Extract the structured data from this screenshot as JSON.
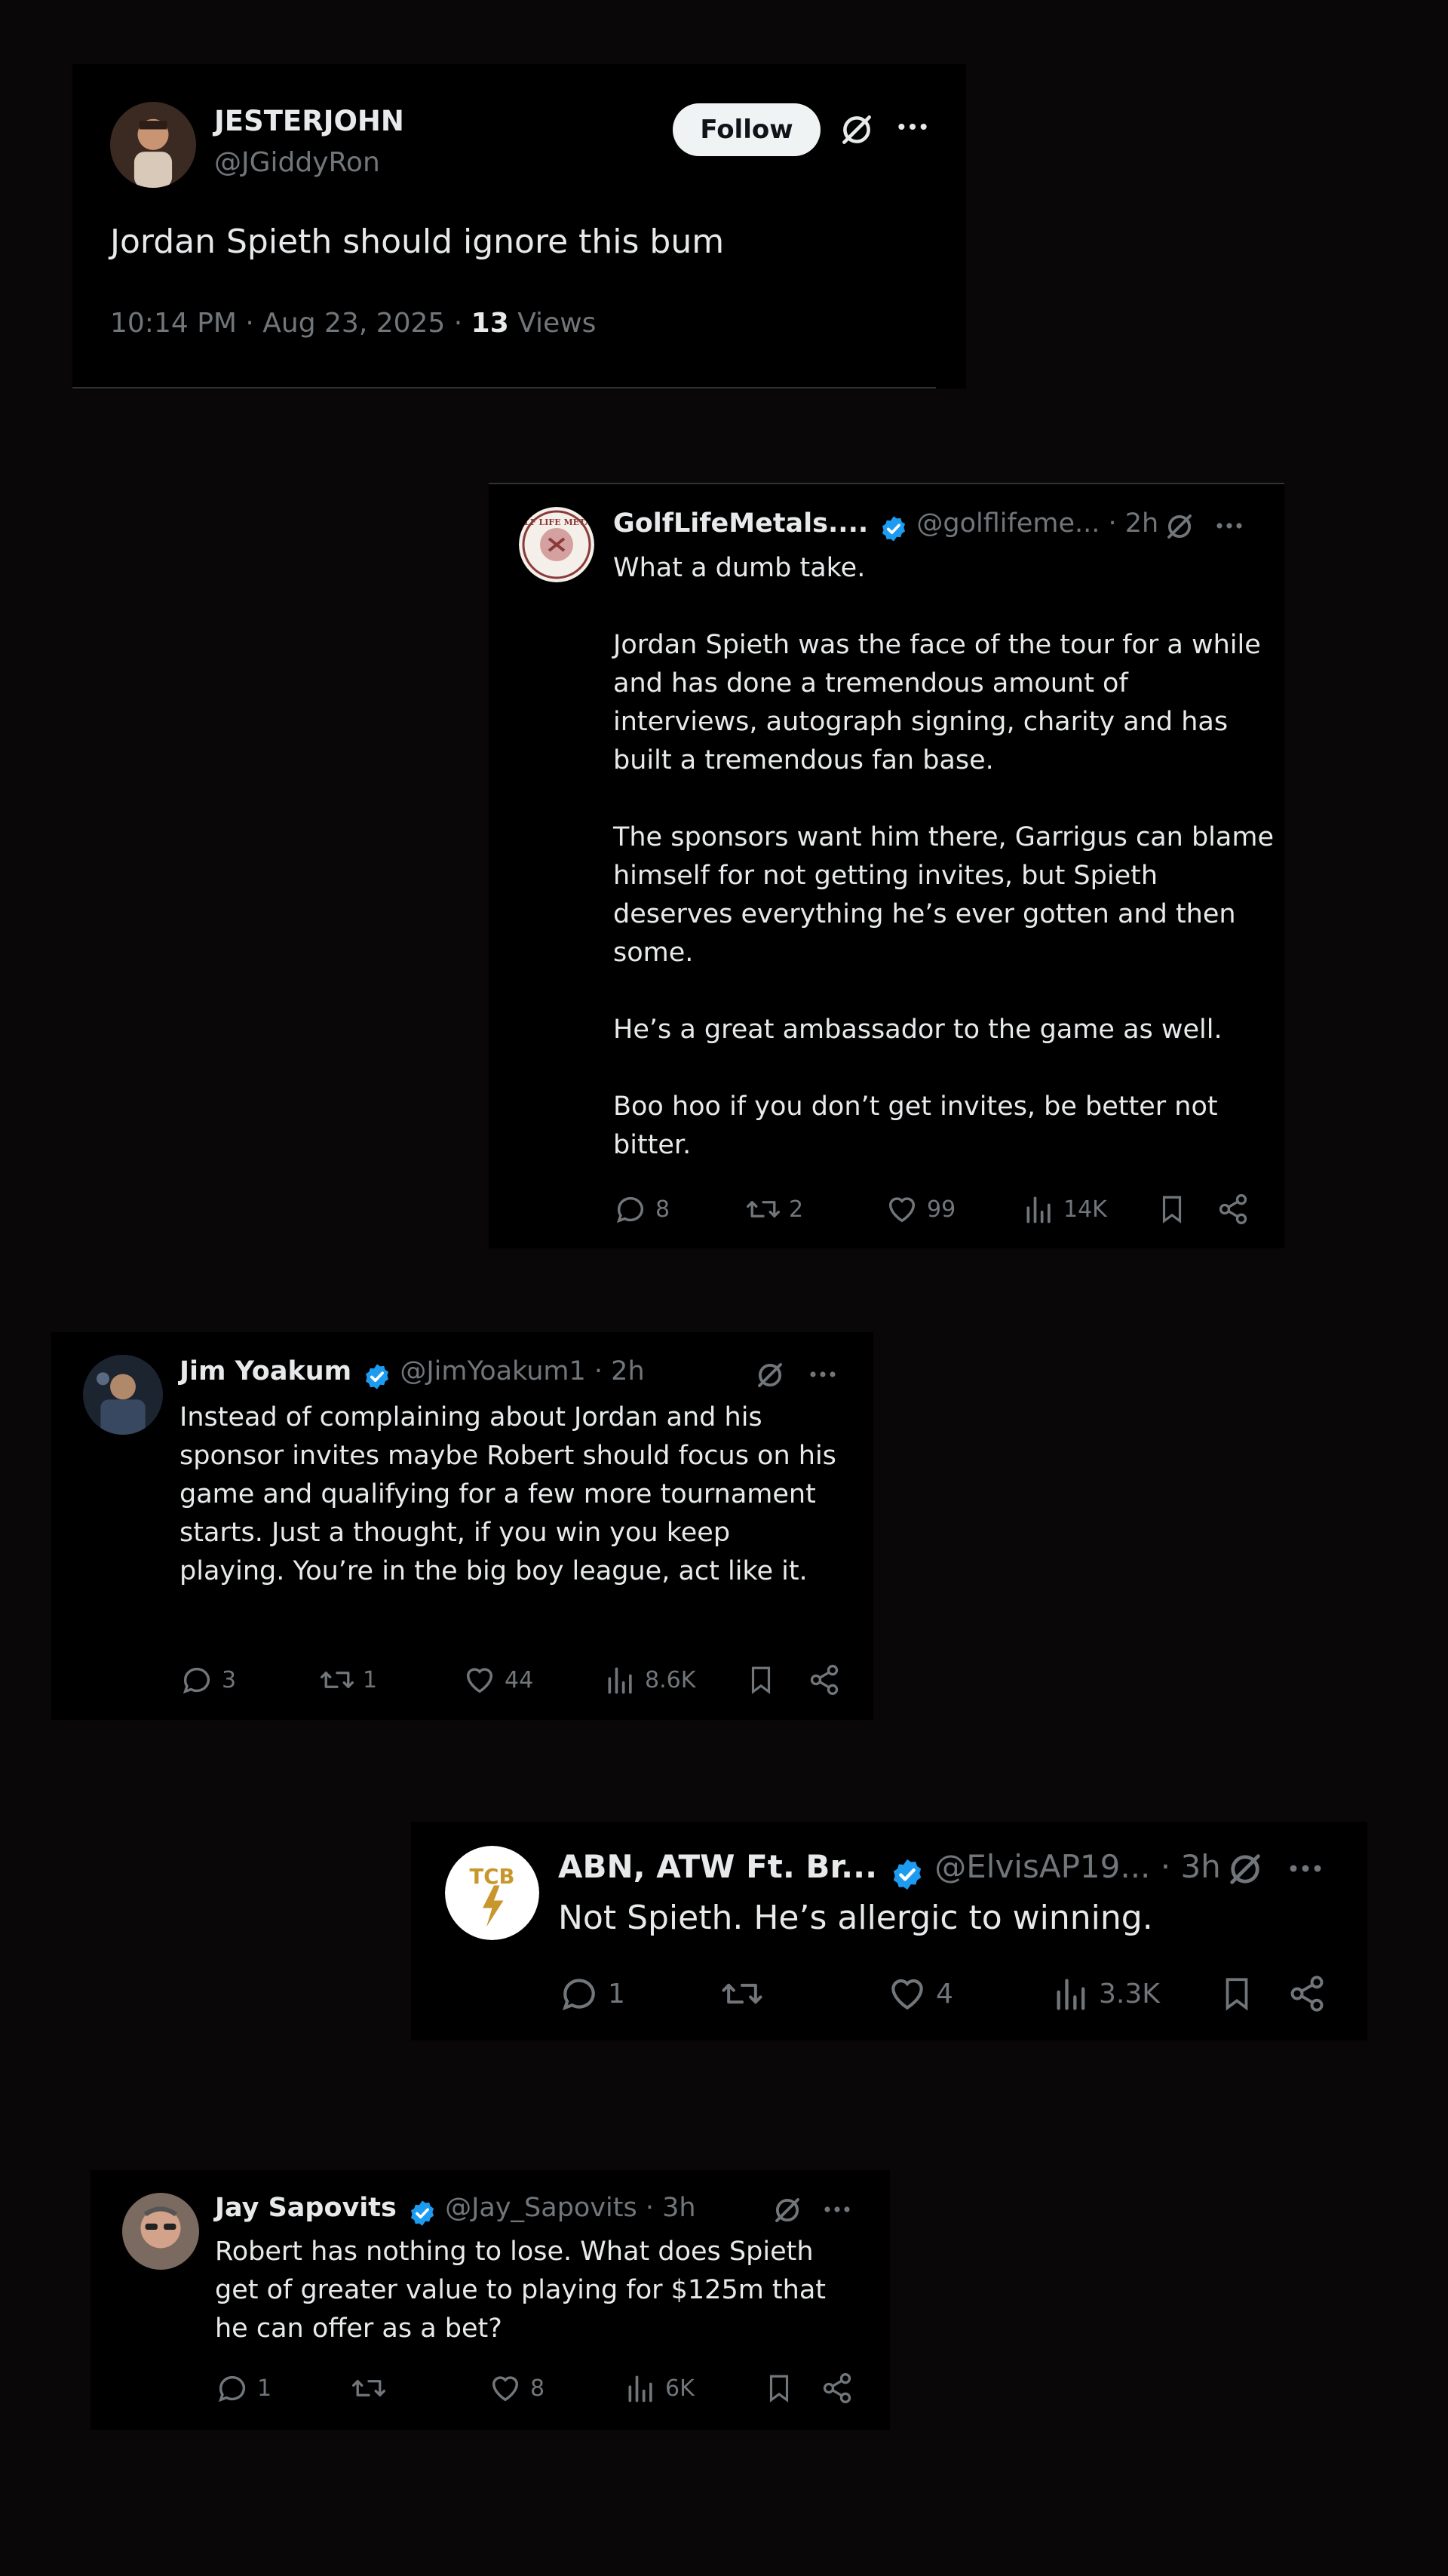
{
  "original_post": {
    "display_name": "JESTERJOHN",
    "handle": "@JGiddyRon",
    "follow_label": "Follow",
    "text": "Jordan Spieth should ignore this bum",
    "time": "10:14 PM · Aug 23, 2025 · ",
    "views_count": "13",
    "views_label": " Views"
  },
  "replies": [
    {
      "display_name": "GolfLifeMetals....",
      "handle": "@golflifeme... · 2h",
      "avatar_text": "GOLF LIFE METALS",
      "text": "What a dumb take.\n\nJordan Spieth was the face of the tour for a while and has done a tremendous amount of interviews, autograph signing, charity and has built a tremendous fan base.\n\nThe sponsors want him there, Garrigus can blame himself for not getting invites, but Spieth deserves everything he’s ever gotten and then some.\n\nHe’s a great ambassador to the game as well.\n\nBoo hoo if you don’t get invites, be better not bitter.",
      "replies": "8",
      "reposts": "2",
      "likes": "99",
      "views": "14K"
    },
    {
      "display_name": "Jim Yoakum",
      "handle": "@JimYoakum1 · 2h",
      "text": "Instead of complaining about Jordan and his sponsor invites maybe Robert should focus on his game and qualifying for a few more tournament starts. Just a thought, if you win you keep playing. You’re in the big boy league, act like it.",
      "replies": "3",
      "reposts": "1",
      "likes": "44",
      "views": "8.6K"
    },
    {
      "display_name": "ABN, ATW Ft. Br...",
      "handle": "@ElvisAP19... · 3h",
      "avatar_text": "TCB",
      "text": "Not Spieth. He’s allergic to winning.",
      "replies": "1",
      "reposts": "",
      "likes": "4",
      "views": "3.3K"
    },
    {
      "display_name": "Jay Sapovits",
      "handle": "@Jay_Sapovits · 3h",
      "text": "Robert has nothing to lose. What does Spieth get of greater value to playing for $125m that he can offer as a bet?",
      "replies": "1",
      "reposts": "",
      "likes": "8",
      "views": "6K"
    }
  ],
  "colors": {
    "background": "#0a0709",
    "card": "#000000",
    "text": "#e7e9ea",
    "muted": "#71767b",
    "verified_blue": "#1d9bf0",
    "follow_button": "#eff3f4"
  },
  "icons": [
    "grok-icon",
    "more-icon",
    "verified-badge-icon",
    "reply-icon",
    "repost-icon",
    "like-icon",
    "views-icon",
    "bookmark-icon",
    "share-icon"
  ]
}
